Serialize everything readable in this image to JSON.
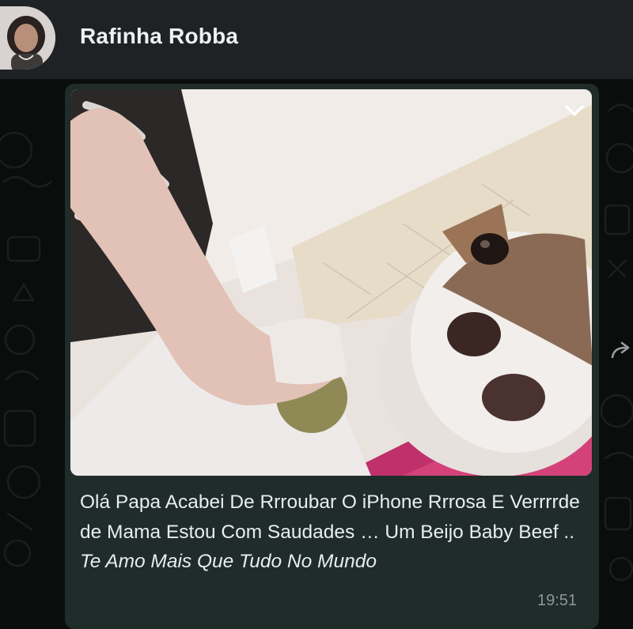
{
  "header": {
    "contact_name": "Rafinha Robba",
    "avatar_icon": "contact-avatar"
  },
  "message": {
    "image_description_icon": "dog-photo",
    "caption_plain": "Olá Papa Acabei De Rrroubar O iPhone Rrrosa E Verrrrde de Mama Estou Com Saudades … Um Beijo Baby Beef .. ",
    "caption_italic": "Te Amo Mais Que Tudo No Mundo",
    "time": "19:51",
    "menu_icon": "chevron-down-icon",
    "forward_icon": "forward-icon"
  },
  "colors": {
    "background": "#0b0d0d",
    "header": "#1f2225",
    "bubble": "#1f2c2a",
    "text": "#e9edef",
    "time": "#8d9598"
  }
}
